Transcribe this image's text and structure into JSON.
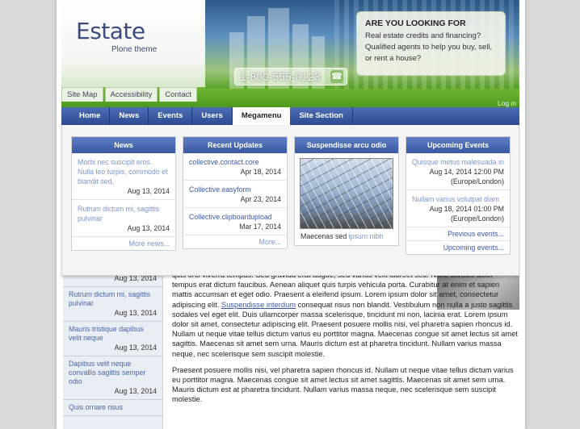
{
  "header": {
    "logo": "Estate",
    "logo_sub": "Plone theme",
    "phone": "1-800-555-0123",
    "callout_title": "ARE YOU LOOKING FOR",
    "callout_text": "Real estate credits and financing? Qualified agents to help you buy, sell, or rent a house?",
    "site_actions": [
      "Site Map",
      "Accessibility",
      "Contact"
    ],
    "login": "Log in"
  },
  "nav": {
    "items": [
      "Home",
      "News",
      "Events",
      "Users",
      "Megamenu",
      "Site Section"
    ],
    "active": "Megamenu"
  },
  "megamenu": {
    "news": {
      "title": "News",
      "items": [
        {
          "text": "Morbi nec suscipit eros. Nulla leo turpis, commodo et blandit sed,",
          "date": "Aug 13, 2014"
        },
        {
          "text": "Rutrum dictum mi, sagittis pulvinar",
          "date": "Aug 13, 2014"
        }
      ],
      "more": "More news..."
    },
    "updates": {
      "title": "Recent Updates",
      "items": [
        {
          "text": "collective.contact.core",
          "date": "Apr 18, 2014"
        },
        {
          "text": "Collective.easyform",
          "date": "Apr 23, 2014"
        },
        {
          "text": "Collective.clipboardupload",
          "date": "Mar 17, 2014"
        }
      ],
      "more": "More..."
    },
    "image": {
      "title": "Suspendisse arcu odio",
      "caption": "Maecenas sed",
      "caption_link": "ipsum nibh"
    },
    "events": {
      "title": "Upcoming Events",
      "items": [
        {
          "text": "Quisque metus malesuada in",
          "date": "Aug 14, 2014 12:00 PM",
          "zone": "(Europe/London)"
        },
        {
          "text": "Nullam varius volutpat diam",
          "date": "Aug 18, 2014 01:00 PM",
          "zone": "(Europe/London)"
        }
      ],
      "previous": "Previous events...",
      "upcoming": "Upcoming events..."
    }
  },
  "sidebar": {
    "items": [
      {
        "text": "",
        "date": "Aug 13, 2014"
      },
      {
        "text": "Rutrum dictum mi, sagittis pulvinar",
        "date": "Aug 13, 2014"
      },
      {
        "text": "Mauris tristique dapibus velit neque",
        "date": "Aug 13, 2014"
      },
      {
        "text": "Dapibus velit neque convallis sagittis semper odio",
        "date": "Aug 13, 2014"
      },
      {
        "text": "Quis ornare risus",
        "date": ""
      }
    ]
  },
  "content": {
    "p1_before": "quis orci viverra tempus. Sed gravida erat augue, sed varius velit laoreet sed. Nunc ultrices dolor tempus erat dictum faucibus. Aenean aliquet quis turpis vehicula porta. Curabitur at enim et sapien mattis accumsan et eget odio. Praesent a eleifend ipsum. Lorem ipsum dolor sit amet, consectetur adipiscing elit.",
    "p1_link": "Suspendisse interdum",
    "p1_after": "consequat risus non blandit. Vestibulum non nulla a justo sagittis sodales vel eget elit. Duis ullamcorper massa scelerisque, tincidunt mi non, lacinia erat. Lorem ipsum dolor sit amet, consectetur adipiscing elit. Praesent posuere mollis nisi, vel pharetra sapien rhoncus id. Nullam ut neque vitae tellus dictum varius eu porttitor magna. Maecenas congue sit amet lectus sit amet sagittis. Maecenas sit amet sem urna. Mauris dictum est at pharetra tincidunt. Nullam varius massa neque, nec scelerisque sem suscipit molestie.",
    "p2": "Praesent posuere mollis nisi, vel pharetra sapien rhoncus id. Nullam ut neque vitae tellus dictum varius eu porttitor magna. Maecenas congue sit amet lectus sit amet sagittis. Maecenas sit amet sem urna. Mauris dictum est at pharetra tincidunt. Nullam varius massa neque, nec scelerisque sem suscipit molestie."
  }
}
